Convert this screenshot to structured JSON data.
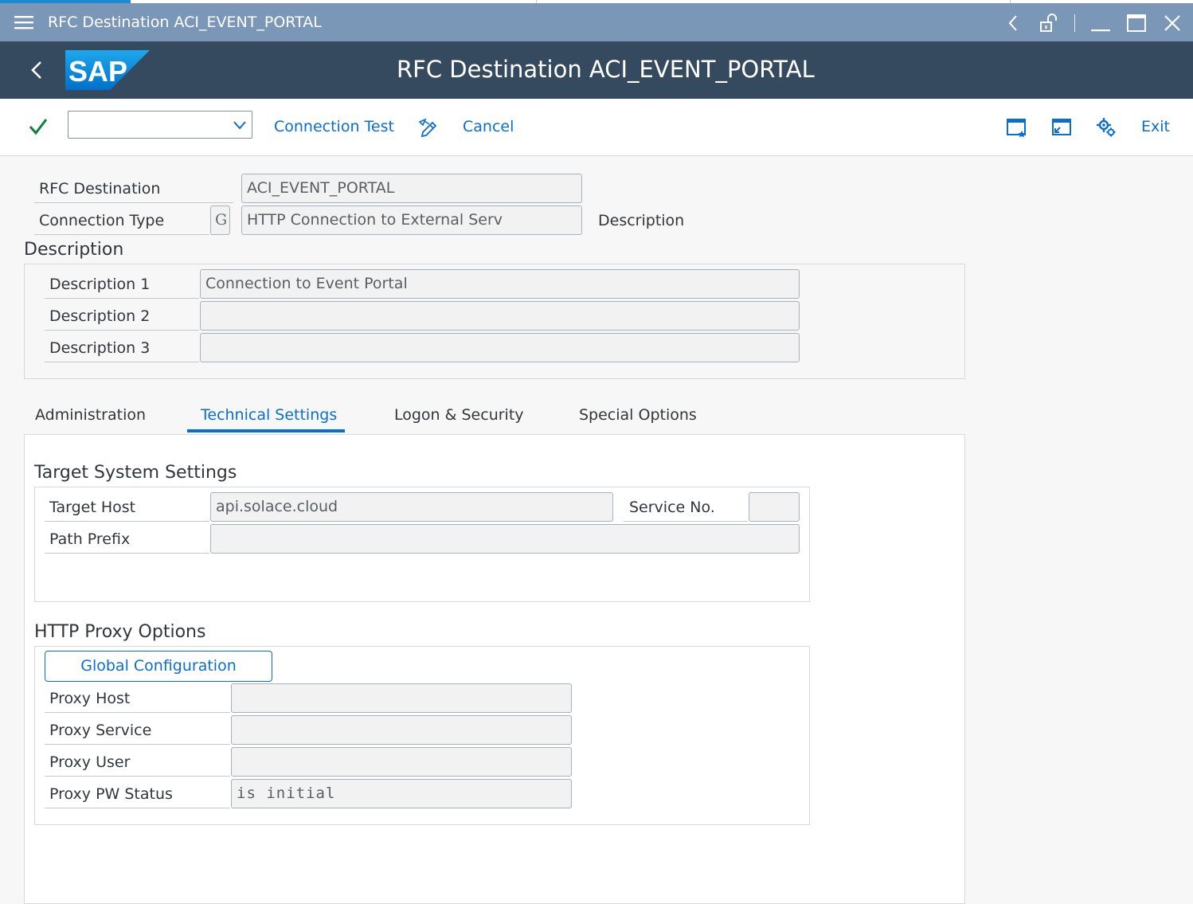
{
  "window": {
    "title": "RFC Destination ACI_EVENT_PORTAL"
  },
  "shell": {
    "logo_text": "SAP",
    "app_title": "RFC Destination ACI_EVENT_PORTAL"
  },
  "toolbar": {
    "command_value": "",
    "connection_test_label": "Connection Test",
    "cancel_label": "Cancel",
    "exit_label": "Exit"
  },
  "header": {
    "rfc_destination_label": "RFC Destination",
    "rfc_destination_value": "ACI_EVENT_PORTAL",
    "connection_type_label": "Connection Type",
    "connection_type_code": "G",
    "connection_type_text": "HTTP Connection to External Serv",
    "description_side_label": "Description"
  },
  "description": {
    "title": "Description",
    "rows": [
      {
        "label": "Description 1",
        "value": "Connection to Event Portal"
      },
      {
        "label": "Description 2",
        "value": ""
      },
      {
        "label": "Description 3",
        "value": ""
      }
    ]
  },
  "tabs": [
    {
      "label": "Administration",
      "active": false
    },
    {
      "label": "Technical Settings",
      "active": true
    },
    {
      "label": "Logon & Security",
      "active": false
    },
    {
      "label": "Special Options",
      "active": false
    }
  ],
  "target_system": {
    "title": "Target System Settings",
    "target_host_label": "Target Host",
    "target_host_value": "api.solace.cloud",
    "service_no_label": "Service No.",
    "service_no_value": "",
    "path_prefix_label": "Path Prefix",
    "path_prefix_value": ""
  },
  "proxy": {
    "title": "HTTP Proxy Options",
    "global_config_label": "Global Configuration",
    "rows": [
      {
        "label": "Proxy Host",
        "value": ""
      },
      {
        "label": "Proxy Service",
        "value": ""
      },
      {
        "label": "Proxy User",
        "value": ""
      },
      {
        "label": "Proxy PW Status",
        "value": "is initial"
      }
    ]
  },
  "colors": {
    "titlebar": "#7b97b8",
    "shellbar": "#354a5f",
    "accent": "#0a6ed1",
    "check_green": "#107e3e"
  }
}
